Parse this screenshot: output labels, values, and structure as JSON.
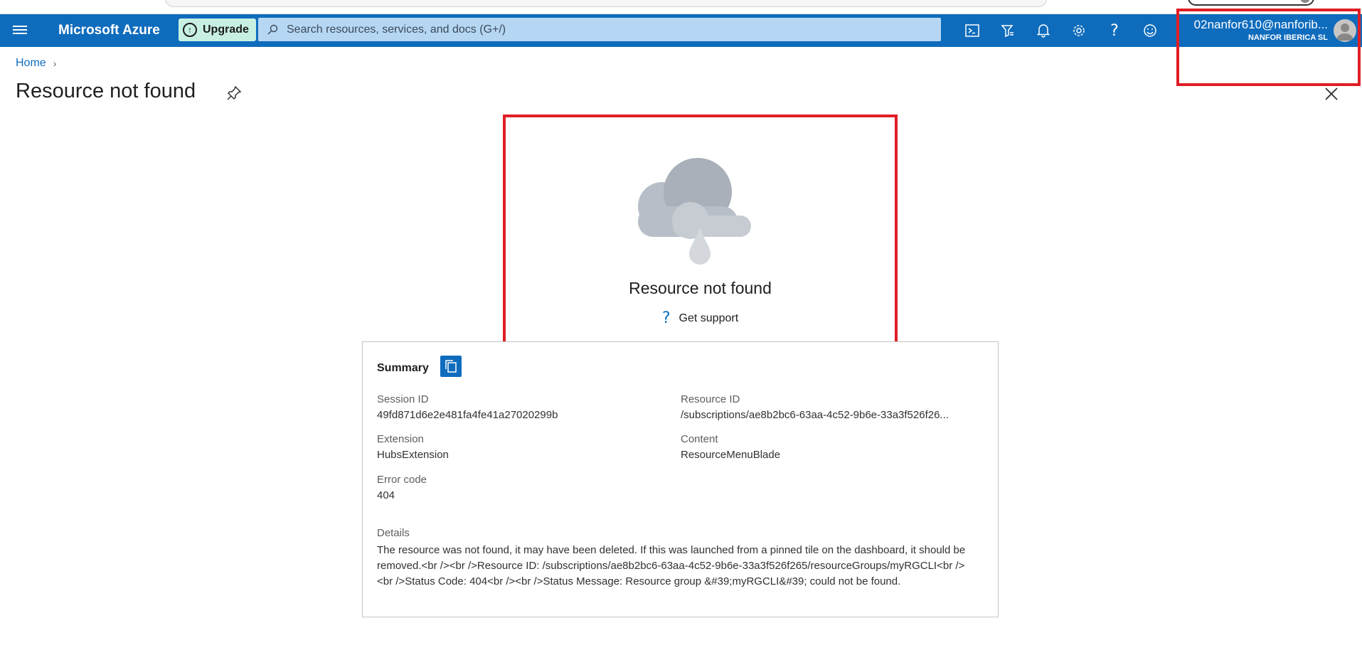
{
  "header": {
    "menu_icon": "hamburger-menu-icon",
    "brand": "Microsoft Azure",
    "upgrade_label": "Upgrade",
    "search_placeholder": "Search resources, services, and docs (G+/)",
    "icons": [
      "cloud-shell-icon",
      "directory-filter-icon",
      "notifications-bell-icon",
      "settings-gear-icon",
      "help-icon",
      "feedback-smiley-icon"
    ],
    "account": {
      "email": "02nanfor610@nanforib...",
      "org": "NANFOR IBERICA SL"
    }
  },
  "breadcrumb": {
    "home": "Home"
  },
  "page": {
    "title": "Resource not found"
  },
  "notfound": {
    "title": "Resource not found",
    "support_label": "Get support"
  },
  "summary": {
    "heading": "Summary",
    "session_id_label": "Session ID",
    "session_id": "49fd871d6e2e481fa4fe41a27020299b",
    "resource_id_label": "Resource ID",
    "resource_id": "/subscriptions/ae8b2bc6-63aa-4c52-9b6e-33a3f526f26...",
    "extension_label": "Extension",
    "extension": "HubsExtension",
    "content_label": "Content",
    "content": "ResourceMenuBlade",
    "error_code_label": "Error code",
    "error_code": "404",
    "details_label": "Details",
    "details": "The resource was not found, it may have been deleted. If this was launched from a pinned tile on the dashboard, it should be removed.<br /><br />Resource ID: /subscriptions/ae8b2bc6-63aa-4c52-9b6e-33a3f526f265/resourceGroups/myRGCLI<br /><br />Status Code: 404<br /><br />Status Message: Resource group &#39;myRGCLI&#39; could not be found."
  },
  "colors": {
    "topbar": "#0f6cbd",
    "highlight": "#e01e26",
    "upgrade_bg": "#c7f0e3",
    "search_bg": "#b6d7f3"
  }
}
